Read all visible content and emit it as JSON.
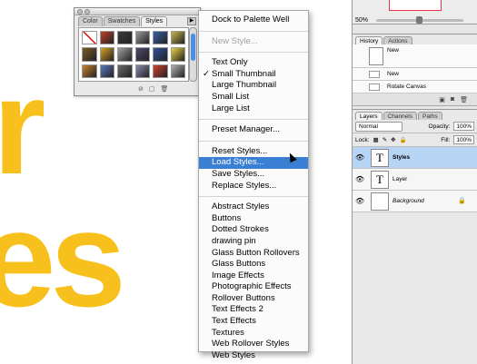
{
  "background": {
    "big_text_1": "r",
    "big_text_2": "es",
    "accent": "#f7c01c"
  },
  "palette": {
    "tabs": [
      "Color",
      "Swatches",
      "Styles"
    ],
    "swatch_colors": [
      "#ffffff",
      "#c0402a",
      "#3a3a3a",
      "#9a9a9a",
      "#3a5fa8",
      "#c7b34a",
      "#7a5a2a",
      "#d4a020",
      "#a0a0a0",
      "#4a4a6a",
      "#3050a0",
      "#e8d040",
      "#c88030",
      "#5a7ac0",
      "#6a6a6a",
      "#8a8ab0",
      "#d04030",
      "#b0b0b0"
    ]
  },
  "menu": {
    "groups": [
      [
        "Dock to Palette Well"
      ],
      [
        "New Style..."
      ],
      [
        "Text Only",
        "Small Thumbnail",
        "Large Thumbnail",
        "Small List",
        "Large List"
      ],
      [
        "Preset Manager..."
      ],
      [
        "Reset Styles...",
        "Load Styles...",
        "Save Styles...",
        "Replace Styles..."
      ],
      [
        "Abstract Styles",
        "Buttons",
        "Dotted Strokes",
        "drawing pin",
        "Glass Button Rollovers",
        "Glass Buttons",
        "Image Effects",
        "Photographic Effects",
        "Rollover Buttons",
        "Text Effects 2",
        "Text Effects",
        "Textures",
        "Web Rollover Styles",
        "Web Styles"
      ]
    ],
    "disabled": [
      "New Style..."
    ],
    "checked": "Small Thumbnail",
    "highlighted": "Load Styles..."
  },
  "navigator": {
    "zoom": "50%"
  },
  "history": {
    "tabs": [
      "History",
      "Actions"
    ],
    "snapshot_label": "New",
    "items": [
      "New",
      "Rotate Canvas"
    ]
  },
  "layers": {
    "tabs": [
      "Layers",
      "Channels",
      "Paths"
    ],
    "blend_mode": "Normal",
    "opacity_label": "Opacity:",
    "opacity": "100%",
    "lock_label": "Lock:",
    "fill_label": "Fill:",
    "fill": "100%",
    "items": [
      {
        "name": "Styles",
        "thumb": "T"
      },
      {
        "name": "Layer",
        "thumb": "T"
      },
      {
        "name": "Background",
        "thumb": ""
      }
    ]
  }
}
